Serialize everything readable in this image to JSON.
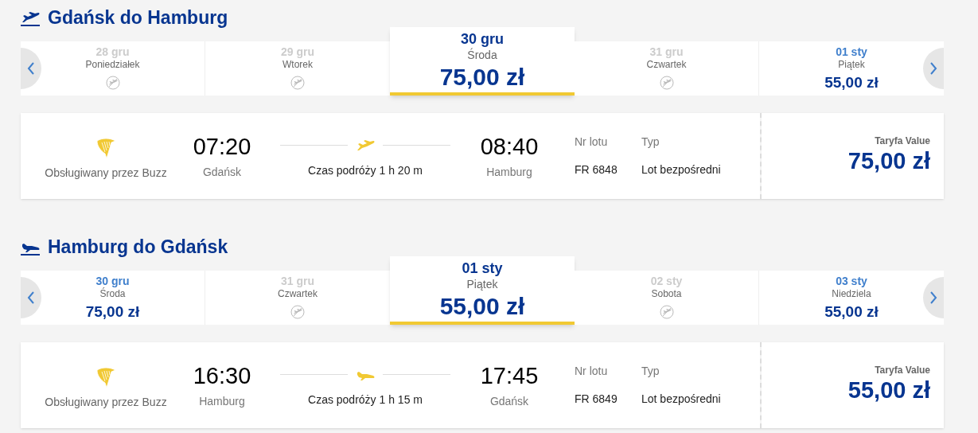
{
  "legs": [
    {
      "kind": "departure",
      "title": "Gdańsk do Hamburg",
      "days": [
        {
          "date": "28 gru",
          "weekday": "Poniedziałek",
          "selected": false
        },
        {
          "date": "29 gru",
          "weekday": "Wtorek",
          "selected": false
        },
        {
          "date": "30 gru",
          "weekday": "Środa",
          "price": "75,00 zł",
          "selected": true
        },
        {
          "date": "31 gru",
          "weekday": "Czwartek",
          "selected": false
        },
        {
          "date": "01 sty",
          "weekday": "Piątek",
          "price": "55,00 zł",
          "selected": false
        }
      ],
      "flight": {
        "operator": "Obsługiwany przez Buzz",
        "dep_time": "07:20",
        "dep_city": "Gdańsk",
        "duration": "Czas podróży 1 h 20 m",
        "arr_time": "08:40",
        "arr_city": "Hamburg",
        "flight_no_label": "Nr lotu",
        "flight_no": "FR 6848",
        "type_label": "Typ",
        "type": "Lot bezpośredni",
        "fare_label": "Taryfa Value",
        "fare": "75,00 zł"
      }
    },
    {
      "kind": "arrival",
      "title": "Hamburg do Gdańsk",
      "days": [
        {
          "date": "30 gru",
          "weekday": "Środa",
          "price": "75,00 zł",
          "selected": false
        },
        {
          "date": "31 gru",
          "weekday": "Czwartek",
          "selected": false
        },
        {
          "date": "01 sty",
          "weekday": "Piątek",
          "price": "55,00 zł",
          "selected": true
        },
        {
          "date": "02 sty",
          "weekday": "Sobota",
          "selected": false
        },
        {
          "date": "03 sty",
          "weekday": "Niedziela",
          "price": "55,00 zł",
          "selected": false
        }
      ],
      "flight": {
        "operator": "Obsługiwany przez Buzz",
        "dep_time": "16:30",
        "dep_city": "Hamburg",
        "duration": "Czas podróży 1 h 15 m",
        "arr_time": "17:45",
        "arr_city": "Gdańsk",
        "flight_no_label": "Nr lotu",
        "flight_no": "FR 6849",
        "type_label": "Typ",
        "type": "Lot bezpośredni",
        "fare_label": "Taryfa Value",
        "fare": "55,00 zł"
      }
    }
  ]
}
